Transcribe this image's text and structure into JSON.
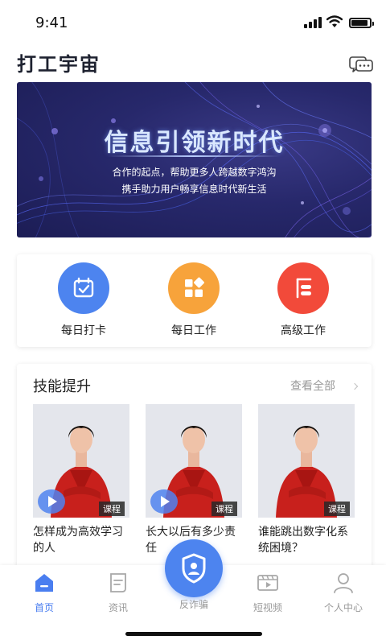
{
  "status_bar": {
    "time": "9:41"
  },
  "header": {
    "title": "打工宇宙"
  },
  "banner": {
    "title": "信息引领新时代",
    "line1": "合作的起点，帮助更多人跨越数字鸿沟",
    "line2": "携手助力用户畅享信息时代新生活"
  },
  "quick_actions": [
    {
      "label": "每日打卡",
      "icon": "calendar-check-icon",
      "color": "#4d84ef"
    },
    {
      "label": "每日工作",
      "icon": "grid-apps-icon",
      "color": "#f7a33b"
    },
    {
      "label": "高级工作",
      "icon": "document-list-icon",
      "color": "#f24a3a"
    }
  ],
  "skills": {
    "title": "技能提升",
    "more_label": "查看全部",
    "badge_label": "课程",
    "courses": [
      {
        "title": "怎样成为高效学习的人",
        "has_play": true
      },
      {
        "title": "长大以后有多少责任",
        "has_play": true
      },
      {
        "title": "谁能跳出数字化系统困境？",
        "has_play": false
      }
    ]
  },
  "bottom_nav": {
    "items": [
      {
        "label": "首页",
        "icon": "home-icon",
        "active": true
      },
      {
        "label": "资讯",
        "icon": "news-icon",
        "active": false
      },
      {
        "label": "反诈骗",
        "icon": "shield-user-icon",
        "active": false
      },
      {
        "label": "短视频",
        "icon": "video-icon",
        "active": false
      },
      {
        "label": "个人中心",
        "icon": "person-icon",
        "active": false
      }
    ]
  },
  "colors": {
    "accent": "#4d84ef",
    "orange": "#f7a33b",
    "red": "#f24a3a",
    "banner_bg": "#27286b"
  }
}
